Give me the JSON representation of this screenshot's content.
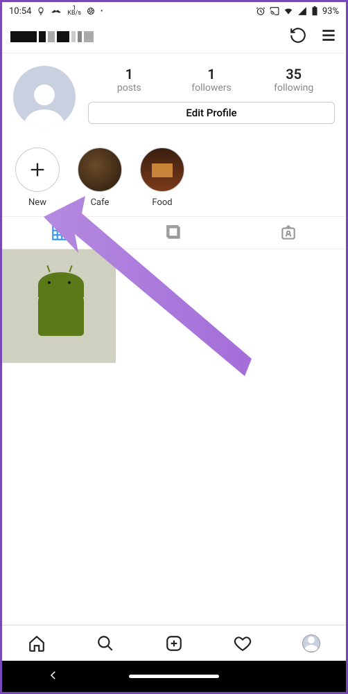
{
  "status": {
    "time": "10:54",
    "kbs_value": "1",
    "kbs_unit": "KB/s",
    "battery_pct": "93%"
  },
  "stats": {
    "posts": {
      "count": "1",
      "label": "posts"
    },
    "followers": {
      "count": "1",
      "label": "followers"
    },
    "following": {
      "count": "35",
      "label": "following"
    }
  },
  "edit_profile_label": "Edit Profile",
  "highlights": {
    "new": "New",
    "cafe": "Cafe",
    "food": "Food"
  }
}
